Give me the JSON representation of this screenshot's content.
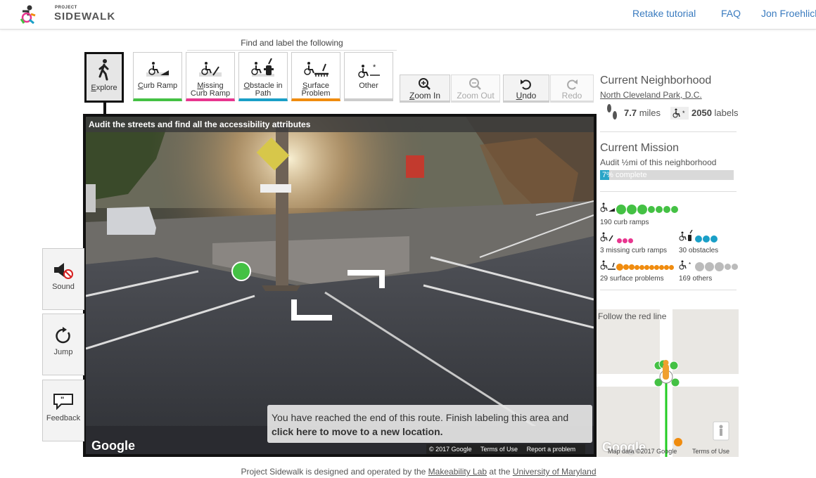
{
  "header": {
    "logo_small": "PROJECT",
    "logo_big": "SIDEWALK",
    "nav": [
      "Retake tutorial",
      "FAQ",
      "Jon Froehlich"
    ]
  },
  "toolbar": {
    "find_title": "Find and label the following",
    "tools": [
      {
        "label_u": "E",
        "label": "xplore",
        "line2": ""
      },
      {
        "label_u": "C",
        "label": "urb Ramp",
        "line2": "",
        "color": "#44c144"
      },
      {
        "label_u": "M",
        "label": "issing",
        "line2": "Curb Ramp",
        "color": "#e8368f"
      },
      {
        "label_u": "O",
        "label": "bstacle in",
        "line2": "Path",
        "color": "#1a9fc7"
      },
      {
        "label_u": "S",
        "label": "urface",
        "line2": "Problem",
        "color": "#f08c0f"
      },
      {
        "label_u": "",
        "label": "Other",
        "line2": "",
        "color": "#bbbbbb"
      }
    ],
    "controls": [
      {
        "label_u": "Z",
        "label": "oom In"
      },
      {
        "label_u": "",
        "label": "Zoom Out"
      },
      {
        "label_u": "U",
        "label": "ndo"
      },
      {
        "label_u": "",
        "label": "Redo"
      }
    ]
  },
  "pano": {
    "banner": "Audit the streets and find all the accessibility attributes",
    "end_msg_1": "You have reached the end of this route. Finish labeling this area and",
    "end_msg_2": "click here to move to a new location.",
    "google": "Google",
    "foot": [
      "© 2017 Google",
      "Terms of Use",
      "Report a problem"
    ]
  },
  "side": {
    "sound": "Sound",
    "jump": "Jump",
    "feedback": "Feedback"
  },
  "neighborhood": {
    "title": "Current Neighborhood",
    "name": "North Cleveland Park, D.C.",
    "miles_value": "7.7",
    "miles_unit": "miles",
    "labels_value": "2050",
    "labels_unit": "labels"
  },
  "mission": {
    "title": "Current Mission",
    "desc": "Audit ½mi of this neighborhood",
    "progress_text": "7% complete",
    "progress_fraction": 0.07
  },
  "label_counts": {
    "curb": "190 curb ramps",
    "missing": "3 missing curb ramps",
    "obstacles": "30 obstacles",
    "surface": "29 surface problems",
    "others": "169 others"
  },
  "minimap": {
    "title": "Follow the red line",
    "foot_google": "Google",
    "foot_data": "Map data ©2017 Google",
    "foot_terms": "Terms of Use"
  },
  "footer": {
    "pre": "Project Sidewalk is designed and operated by the",
    "lab": "Makeability Lab",
    "mid": "at the",
    "univ": "University of Maryland"
  },
  "colors": {
    "curb": "#44c144",
    "missing": "#e8368f",
    "obstacle": "#1a9fc7",
    "surface": "#f08c0f",
    "other": "#bbbbbb",
    "link": "#3a7bbf"
  }
}
